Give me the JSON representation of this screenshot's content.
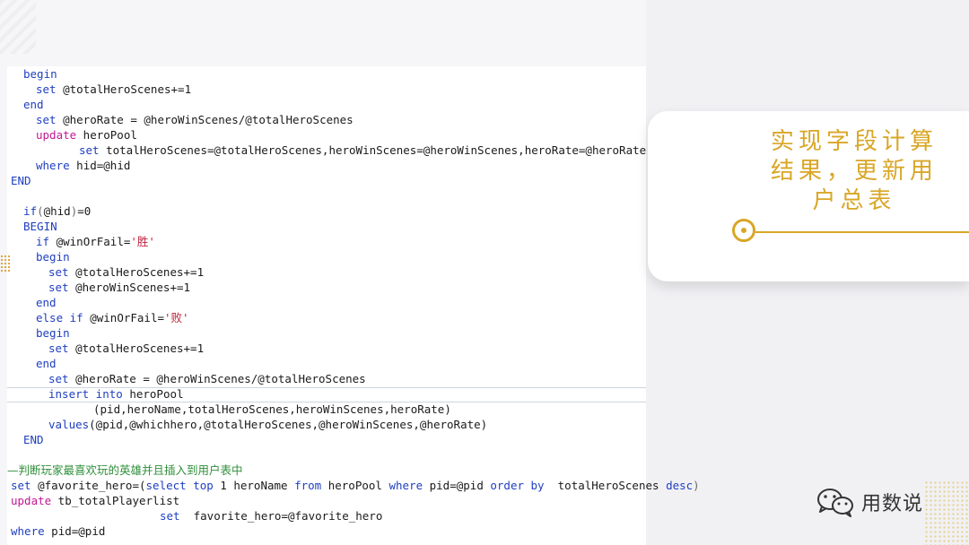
{
  "card": {
    "title": "实现字段计算\n结果，更新用\n户总表",
    "accent_color": "#d9a626",
    "icon": "ring-marker-icon"
  },
  "watermark": {
    "icon": "wechat-icon",
    "text": "用数说"
  },
  "code": {
    "l1_begin": "begin",
    "l2_set": "set",
    "l2_rest": " @totalHeroScenes+=1",
    "l3_end": "end",
    "l4_set": "set",
    "l4_rest": " @heroRate = @heroWinScenes/@totalHeroScenes",
    "l5_update": "update",
    "l5_rest": " heroPool",
    "l6_set": "set",
    "l6_rest": " totalHeroScenes=@totalHeroScenes,heroWinScenes=@heroWinScenes,heroRate=@heroRate",
    "l7_where": "where",
    "l7_rest": " hid=@hid",
    "l8_END": "END",
    "l9_if": "if",
    "l9_paren1": "(",
    "l9_mid": "@hid",
    "l9_paren2": ")",
    "l9_rest": "=0",
    "l10_BEGIN": "BEGIN",
    "l11_if": "if",
    "l11_var": " @winOrFail=",
    "l11_str": "'胜'",
    "l12_begin": "begin",
    "l13_set": "set",
    "l13_rest": " @totalHeroScenes+=1",
    "l14_set": "set",
    "l14_rest": " @heroWinScenes+=1",
    "l15_end": "end",
    "l16_else": "else if",
    "l16_var": " @winOrFail=",
    "l16_str": "'败'",
    "l17_begin": "begin",
    "l18_set": "set",
    "l18_rest": " @totalHeroScenes+=1",
    "l19_end": "end",
    "l20_set": "set",
    "l20_rest": " @heroRate = @heroWinScenes/@totalHeroScenes",
    "l21_insert": "insert into",
    "l21_rest": " heroPool",
    "l22_cols": "(pid,heroName,totalHeroScenes,heroWinScenes,heroRate)",
    "l23_values": "values",
    "l23_rest": "(@pid,@whichhero,@totalHeroScenes,@heroWinScenes,@heroRate)",
    "l24_END": "END",
    "l25_comment": "—判断玩家最喜欢玩的英雄并且插入到用户表中",
    "l26_set": "set",
    "l26_a": " @favorite_hero=(",
    "l26_select": "select top",
    "l26_b": " 1 heroName ",
    "l26_from": "from",
    "l26_c": " heroPool ",
    "l26_where": "where",
    "l26_d": " pid=@pid ",
    "l26_order": "order by",
    "l26_e": "  totalHeroScenes ",
    "l26_desc": "desc",
    "l26_f": ")",
    "l27_update": "update",
    "l27_rest": " tb_totalPlayerlist",
    "l28_set": "set",
    "l28_rest": "  favorite_hero=@favorite_hero",
    "l29_where": "where",
    "l29_rest": " pid=@pid"
  }
}
